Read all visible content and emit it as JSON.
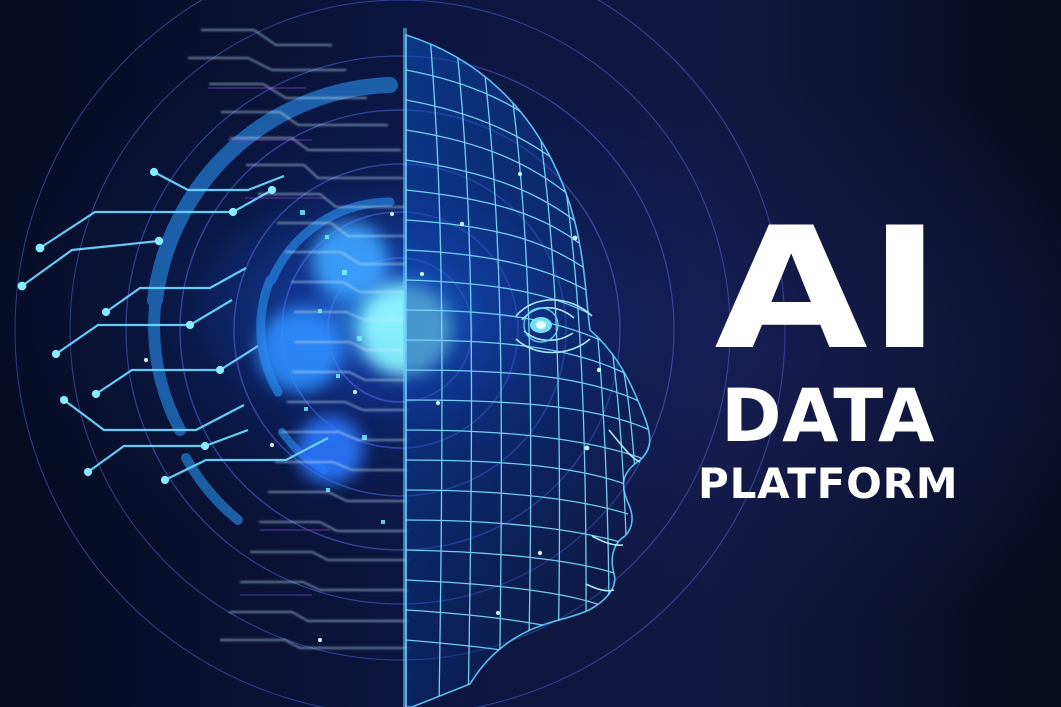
{
  "hero": {
    "line1": "AI",
    "line2": "DATA",
    "line3": "PLATFORM"
  },
  "visual": {
    "subject": "ai-face",
    "colors": {
      "background": "#070b1f",
      "glow": "#2b8cff",
      "wire": "#9ce8ff",
      "accent": "#7b6dff"
    }
  }
}
